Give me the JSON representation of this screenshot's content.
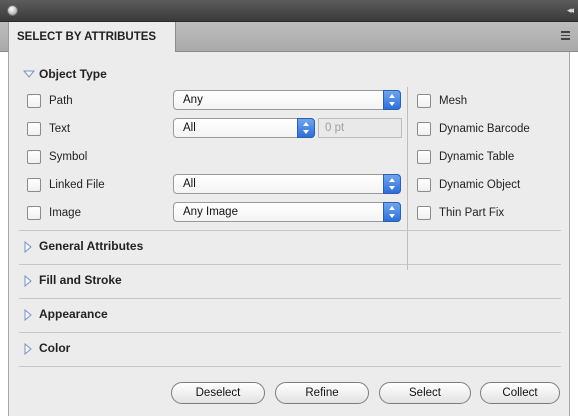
{
  "panel": {
    "tab_title": "SELECT BY ATTRIBUTES"
  },
  "object_type": {
    "title": "Object Type",
    "left_items": [
      {
        "label": "Path",
        "checked": false,
        "dropdown": "Any"
      },
      {
        "label": "Text",
        "checked": false,
        "dropdown": "All",
        "point_value": "0 pt"
      },
      {
        "label": "Symbol",
        "checked": false
      },
      {
        "label": "Linked File",
        "checked": false,
        "dropdown": "All"
      },
      {
        "label": "Image",
        "checked": false,
        "dropdown": "Any Image"
      }
    ],
    "right_items": [
      {
        "label": "Mesh",
        "checked": false
      },
      {
        "label": "Dynamic Barcode",
        "checked": false
      },
      {
        "label": "Dynamic Table",
        "checked": false
      },
      {
        "label": "Dynamic Object",
        "checked": false
      },
      {
        "label": "Thin Part Fix",
        "checked": false
      }
    ]
  },
  "sections": [
    {
      "title": "General Attributes",
      "expanded": false
    },
    {
      "title": "Fill and Stroke",
      "expanded": false
    },
    {
      "title": "Appearance",
      "expanded": false
    },
    {
      "title": "Color",
      "expanded": false
    }
  ],
  "buttons": {
    "deselect": "Deselect",
    "refine": "Refine",
    "select": "Select",
    "collect": "Collect"
  },
  "colors": {
    "accent": "#3a7be0",
    "panel_bg": "#ececec",
    "titlebar": "#4a4a4a"
  }
}
